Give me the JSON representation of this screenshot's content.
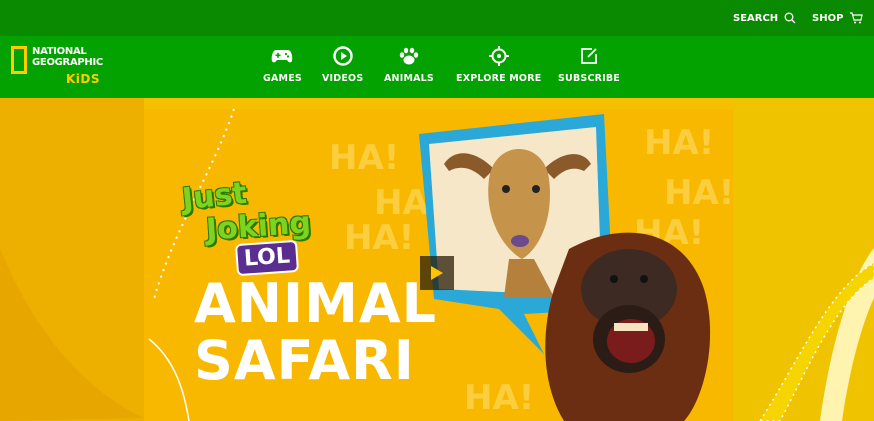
{
  "topbar": {
    "search_label": "SEARCH",
    "search_icon": "search-icon",
    "shop_label": "SHOP",
    "shop_icon": "cart-icon"
  },
  "brand": {
    "line1": "NATIONAL",
    "line2": "GEOGRAPHIC",
    "line3": "KiDS"
  },
  "nav": {
    "items": [
      {
        "label": "GAMES",
        "icon": "gamepad-icon"
      },
      {
        "label": "VIDEOS",
        "icon": "play-circle-icon"
      },
      {
        "label": "ANIMALS",
        "icon": "paw-icon"
      },
      {
        "label": "EXPLORE MORE",
        "icon": "compass-icon"
      },
      {
        "label": "SUBSCRIBE",
        "icon": "edit-icon"
      }
    ]
  },
  "hero": {
    "series_line1": "Just",
    "series_line2": "Joking",
    "badge": "LOL",
    "headline_line1": "ANIMAL",
    "headline_line2": "SAFARI",
    "bg_text": "HA!",
    "play_icon": "play-icon"
  },
  "colors": {
    "topbar": "#0a8a00",
    "navbar": "#04a200",
    "page_bg": "#f2b500",
    "brand_yellow": "#ffcc00",
    "speech_bubble": "#2aa8d8",
    "lol_badge": "#5a2d91"
  }
}
